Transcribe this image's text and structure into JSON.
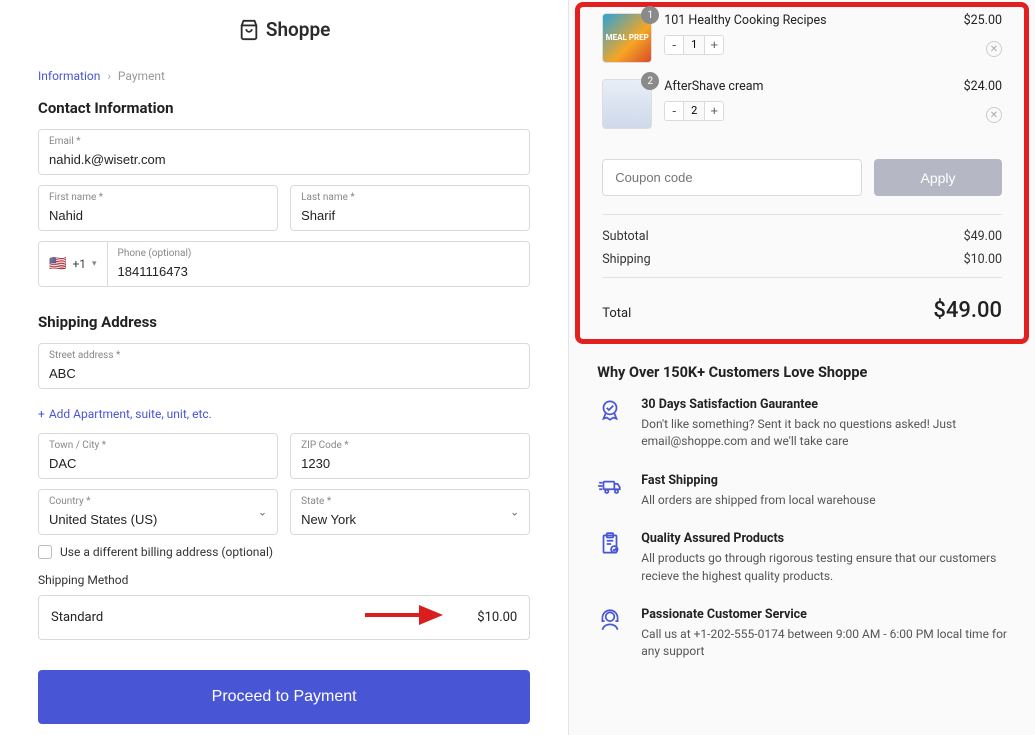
{
  "brand": {
    "name": "Shoppe"
  },
  "breadcrumb": {
    "current": "Information",
    "next": "Payment"
  },
  "contact": {
    "heading": "Contact Information",
    "email_label": "Email *",
    "email_value": "nahid.k@wisetr.com",
    "first_label": "First name *",
    "first_value": "Nahid",
    "last_label": "Last name *",
    "last_value": "Sharif",
    "phone_label": "Phone (optional)",
    "phone_prefix": "+1",
    "phone_value": "1841116473"
  },
  "shipping": {
    "heading": "Shipping Address",
    "street_label": "Street address *",
    "street_value": "ABC",
    "add_apt": "Add Apartment, suite, unit, etc.",
    "city_label": "Town / City *",
    "city_value": "DAC",
    "zip_label": "ZIP Code *",
    "zip_value": "1230",
    "country_label": "Country *",
    "country_value": "United States (US)",
    "state_label": "State *",
    "state_value": "New York",
    "diff_billing": "Use a different billing address (optional)",
    "method_heading": "Shipping Method",
    "method_name": "Standard",
    "method_price": "$10.00"
  },
  "proceed_label": "Proceed to Payment",
  "cart": {
    "items": [
      {
        "name": "101 Healthy Cooking Recipes",
        "qty": "1",
        "price": "$25.00",
        "thumb_text": "MEAL PREP"
      },
      {
        "name": "AfterShave cream",
        "qty": "2",
        "price": "$24.00",
        "thumb_text": ""
      }
    ],
    "coupon_placeholder": "Coupon code",
    "apply_label": "Apply",
    "subtotal_label": "Subtotal",
    "subtotal_value": "$49.00",
    "shipping_label": "Shipping",
    "shipping_value": "$10.00",
    "total_label": "Total",
    "total_value": "$49.00"
  },
  "love": {
    "heading": "Why Over 150K+ Customers Love Shoppe",
    "benefits": [
      {
        "title": "30 Days Satisfaction Gaurantee",
        "text": "Don't like something? Sent it back no questions asked! Just email@shoppe.com and we'll take care"
      },
      {
        "title": "Fast Shipping",
        "text": "All orders are shipped from local warehouse"
      },
      {
        "title": "Quality Assured Products",
        "text": "All products go through rigorous testing ensure that our customers recieve the highest quality products."
      },
      {
        "title": "Passionate Customer Service",
        "text": "Call us at +1-202-555-0174 between 9:00 AM - 6:00 PM local time for any support"
      }
    ]
  }
}
